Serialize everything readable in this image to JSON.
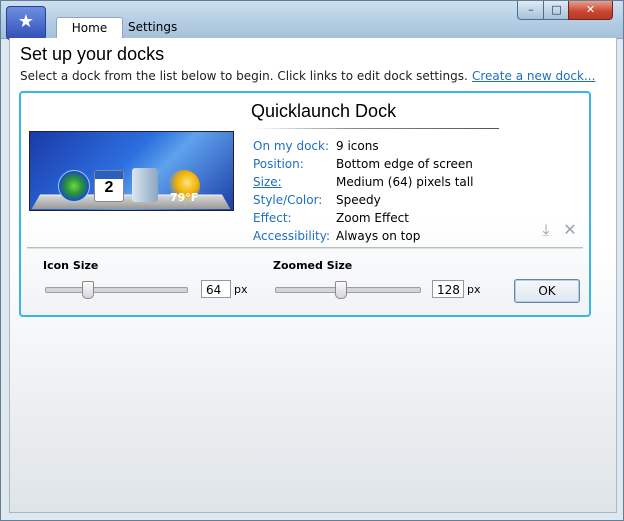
{
  "window": {
    "tabs": [
      {
        "label": "Home",
        "active": true
      },
      {
        "label": "Settings",
        "active": false
      }
    ],
    "controls": {
      "minimize": "–",
      "maximize": "□",
      "close": "✕"
    },
    "app_icon": "rocketdock-icon"
  },
  "page": {
    "heading": "Set up your docks",
    "instructions": "Select a dock from the list below to begin. Click links to edit dock settings.",
    "create_link": "Create a new dock..."
  },
  "dock": {
    "title": "Quicklaunch Dock",
    "preview_icons": [
      "windows-start-icon",
      "calendar-icon",
      "finder-icon",
      "weather-icon"
    ],
    "calendar_day": "2",
    "weather_temp": "79°F",
    "details": [
      {
        "label": "On my dock:",
        "value": "9 icons",
        "link": false
      },
      {
        "label": "Position:",
        "value": "Bottom edge of screen",
        "link": false
      },
      {
        "label": "Size:",
        "value": "Medium (64) pixels tall",
        "link": true
      },
      {
        "label": "Style/Color:",
        "value": "Speedy",
        "link": false
      },
      {
        "label": "Effect:",
        "value": "Zoom Effect",
        "link": false
      },
      {
        "label": "Accessibility:",
        "value": "Always on top",
        "link": false
      }
    ],
    "icon_size": {
      "label": "Icon Size",
      "value": "64",
      "unit": "px",
      "slider_fraction": 0.3
    },
    "zoomed_size": {
      "label": "Zoomed Size",
      "value": "128",
      "unit": "px",
      "slider_fraction": 0.45
    },
    "ok_label": "OK"
  },
  "colors": {
    "accent": "#3cb5e4",
    "link": "#1f6fc0"
  }
}
